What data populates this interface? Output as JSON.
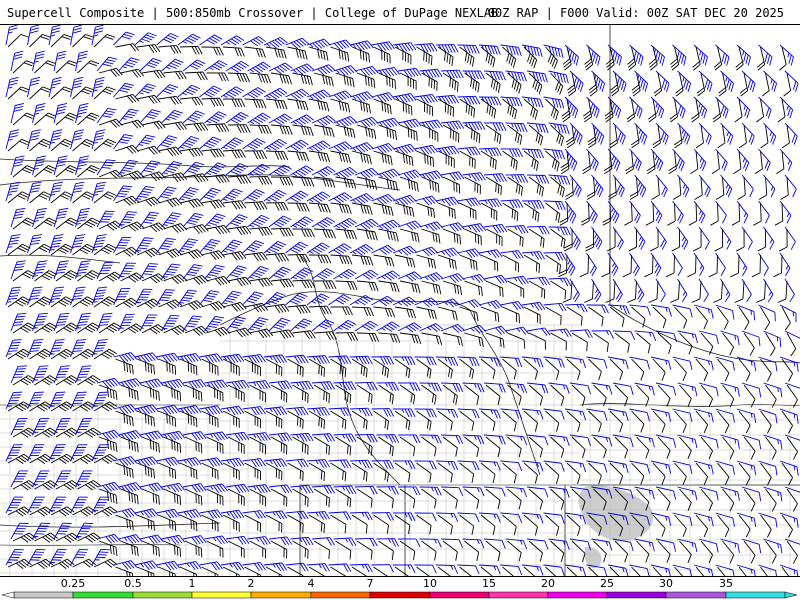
{
  "header": {
    "title_left": "Supercell Composite | 500:850mb Crossover | College of DuPage NEXLAB",
    "title_right": "00Z RAP | F000 Valid: 00Z SAT DEC 20 2025"
  },
  "legend": {
    "ticks": [
      "0.25",
      "0.5",
      "1",
      "2",
      "4",
      "7",
      "10",
      "15",
      "20",
      "25",
      "30",
      "35"
    ],
    "colors": [
      "#ffffff",
      "#c8c8c8",
      "#33dd33",
      "#99dd33",
      "#ffff33",
      "#ffaa00",
      "#ff6600",
      "#dd0000",
      "#ee0077",
      "#ff33aa",
      "#ee00ee",
      "#9900dd",
      "#aa55dd",
      "#33dddd"
    ]
  },
  "map": {
    "barb_colors": {
      "upper": "#0000dd",
      "lower": "#000000",
      "light_upper": "#5577ff"
    },
    "shaded_area_color": "#cccccc"
  }
}
